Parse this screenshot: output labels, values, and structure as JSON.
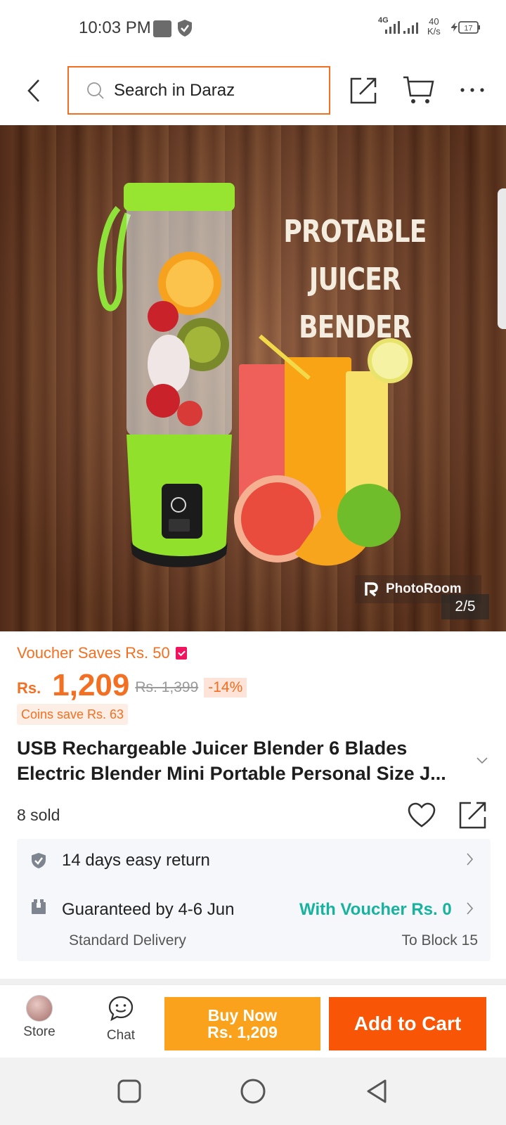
{
  "status_bar": {
    "time": "10:03 PM",
    "network": "4G",
    "speed_value": "40",
    "speed_unit": "K/s",
    "battery": "17"
  },
  "header": {
    "search_placeholder": "Search in Daraz",
    "icons": [
      "back-arrow-icon",
      "search-icon",
      "share-icon",
      "cart-icon",
      "more-icon"
    ]
  },
  "gallery": {
    "headline_line1": "PROTABLE JUICER",
    "headline_line2": "BENDER",
    "watermark": "PhotoRoom",
    "page_indicator": "2/5"
  },
  "pricing": {
    "voucher_text": "Voucher Saves Rs. 50",
    "currency": "Rs.",
    "price": "1,209",
    "original_price": "Rs. 1,399",
    "discount": "-14%",
    "coins": "Coins save Rs. 63",
    "accent_color": "#f36f21"
  },
  "product": {
    "title": "USB Rechargeable Juicer Blender 6 Blades Electric Blender Mini Portable Personal Size J...",
    "sold": "8 sold"
  },
  "delivery": {
    "return_text": "14 days easy return",
    "guarantee_text": "Guaranteed by 4-6 Jun",
    "voucher_shipping": "With Voucher Rs. 0",
    "method": "Standard Delivery",
    "destination": "To Block 15",
    "voucher_color": "#17b39f"
  },
  "action_bar": {
    "store_label": "Store",
    "chat_label": "Chat",
    "buy_now_label": "Buy Now",
    "buy_now_price": "Rs. 1,209",
    "add_to_cart_label": "Add to Cart",
    "buy_color": "#faa21b",
    "cart_color": "#f85606"
  }
}
